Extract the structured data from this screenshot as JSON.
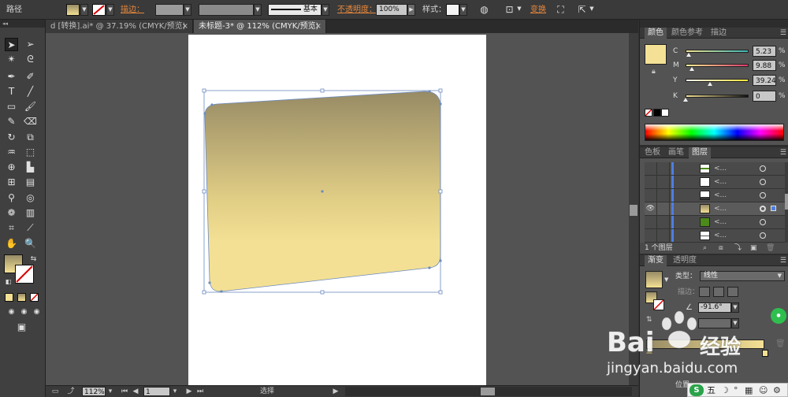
{
  "control_bar": {
    "object_type": "路径",
    "stroke_label": "描边：",
    "style_label": "基本",
    "opacity_label": "不透明度：",
    "opacity_value": "100%",
    "style_text": "样式：",
    "transform_label": "变换"
  },
  "tabs": [
    {
      "label": "d [转换].ai* @ 37.19% (CMYK/预览)",
      "active": false
    },
    {
      "label": "未标题-3* @ 112% (CMYK/预览)",
      "active": true
    }
  ],
  "color_panel": {
    "tabs": [
      "颜色",
      "颜色参考",
      "描边"
    ],
    "channels": [
      {
        "name": "C",
        "value": "5.23",
        "fraction": 0.05
      },
      {
        "name": "M",
        "value": "9.88",
        "fraction": 0.1
      },
      {
        "name": "Y",
        "value": "39.24",
        "fraction": 0.39
      },
      {
        "name": "K",
        "value": "0",
        "fraction": 0.0
      }
    ],
    "pct": "%"
  },
  "layers_panel": {
    "tabs": [
      "色板",
      "画笔",
      "图层"
    ],
    "rows": [
      {
        "name": "<...",
        "visible": false
      },
      {
        "name": "<...",
        "visible": false
      },
      {
        "name": "<...",
        "visible": false
      },
      {
        "name": "<...",
        "visible": true
      },
      {
        "name": "<...",
        "visible": false
      },
      {
        "name": "<...",
        "visible": false
      }
    ],
    "count_label": "1 个图层"
  },
  "gradient_panel": {
    "tabs": [
      "渐变",
      "透明度"
    ],
    "type_label": "类型：",
    "type_value": "线性",
    "stroke_label": "描边：",
    "angle_value": "-91.6°",
    "position_label": "位置"
  },
  "status_bar": {
    "zoom": "112%",
    "page": "1",
    "tool": "选择"
  },
  "watermark": {
    "brand": "Bai",
    "brand2": "经验",
    "url": "jingyan.baidu.com"
  },
  "ime": {
    "label": "五"
  },
  "colors": {
    "fill_top": "#978b65",
    "fill_mid": "#c8b67a",
    "fill_bottom": "#f3e094",
    "swatch": "#f4e195",
    "ui_bg": "#535353",
    "accent": "#e8873a",
    "selection": "#6d8bbf"
  }
}
